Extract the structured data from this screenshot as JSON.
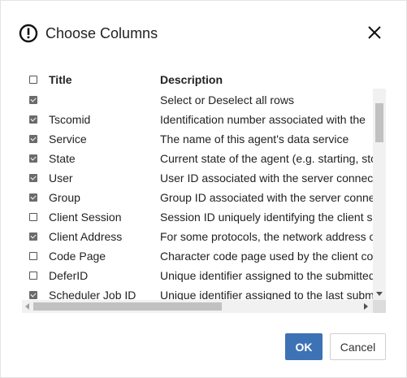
{
  "dialog": {
    "title": "Choose Columns",
    "title_icon": "alert-circle-icon",
    "close_icon": "close-icon"
  },
  "table": {
    "headers": {
      "title": "Title",
      "description": "Description"
    },
    "header_checked": false,
    "rows": [
      {
        "checked": true,
        "title": "",
        "description": "Select or Deselect all rows"
      },
      {
        "checked": true,
        "title": "Tscomid",
        "description": "Identification number associated with the"
      },
      {
        "checked": true,
        "title": "Service",
        "description": "The name of this agent's data service"
      },
      {
        "checked": true,
        "title": "State",
        "description": "Current state of the agent (e.g. starting, sto"
      },
      {
        "checked": true,
        "title": "User",
        "description": "User ID associated with the server connec"
      },
      {
        "checked": true,
        "title": "Group",
        "description": "Group ID associated with the server conne"
      },
      {
        "checked": false,
        "title": "Client Session",
        "description": "Session ID uniquely identifying the client s"
      },
      {
        "checked": true,
        "title": "Client Address",
        "description": "For some protocols, the network address o"
      },
      {
        "checked": false,
        "title": "Code Page",
        "description": "Character code page used by the client co"
      },
      {
        "checked": false,
        "title": "DeferID",
        "description": "Unique identifier assigned to the submitted"
      },
      {
        "checked": true,
        "title": "Scheduler Job ID",
        "description": "Unique identifier assigned to the last subm"
      }
    ]
  },
  "buttons": {
    "ok": "OK",
    "cancel": "Cancel"
  },
  "colors": {
    "primary": "#3d72b5",
    "checkbox": "#6b6b6b"
  }
}
